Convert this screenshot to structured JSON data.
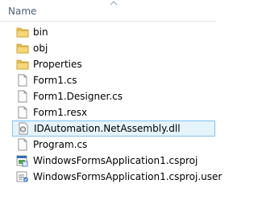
{
  "header": {
    "name_label": "Name"
  },
  "files": [
    {
      "label": "bin",
      "icon": "folder-icon"
    },
    {
      "label": "obj",
      "icon": "folder-icon"
    },
    {
      "label": "Properties",
      "icon": "folder-icon"
    },
    {
      "label": "Form1.cs",
      "icon": "document-icon"
    },
    {
      "label": "Form1.Designer.cs",
      "icon": "document-icon"
    },
    {
      "label": "Form1.resx",
      "icon": "document-icon"
    },
    {
      "label": "IDAutomation.NetAssembly.dll",
      "icon": "dll-gear-icon",
      "selected": true
    },
    {
      "label": "Program.cs",
      "icon": "document-icon"
    },
    {
      "label": "WindowsFormsApplication1.csproj",
      "icon": "csproj-icon"
    },
    {
      "label": "WindowsFormsApplication1.csproj.user",
      "icon": "csproj-user-icon"
    }
  ],
  "colors": {
    "header_text": "#4c607a",
    "selection_fill": "#e5f3fb",
    "selection_border": "#7fc4f4",
    "folder": "#e8c25a"
  }
}
